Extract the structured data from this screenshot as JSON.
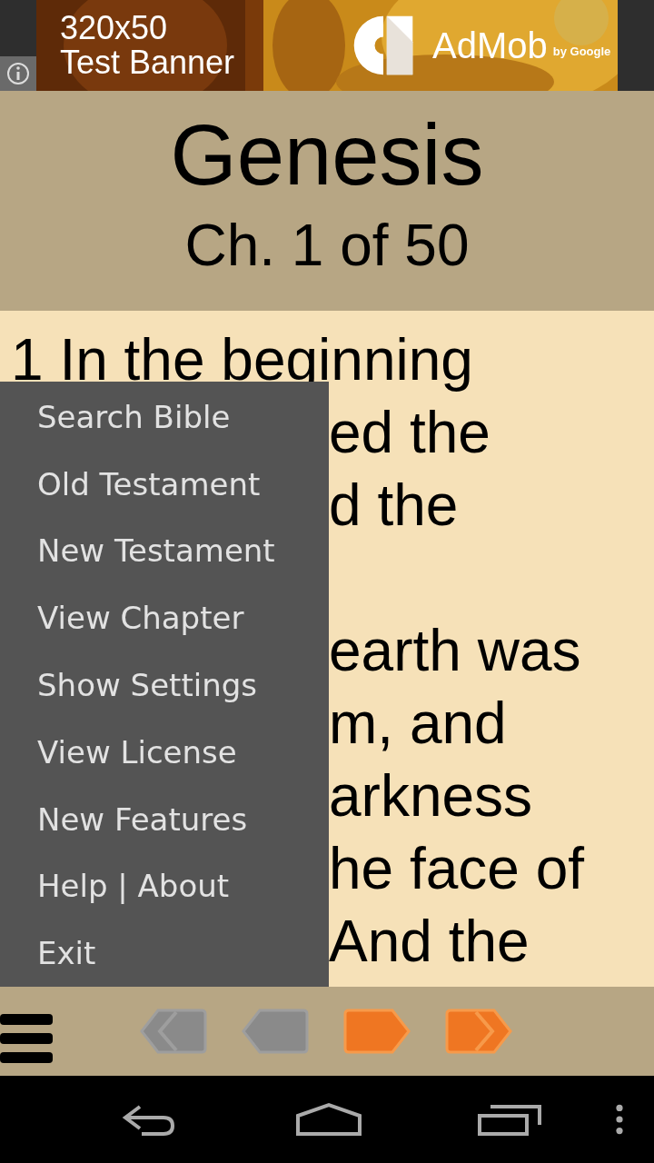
{
  "ad_banner": {
    "size_label": "320x50",
    "label": "Test Banner",
    "brand": "AdMob",
    "brand_suffix": "by Google"
  },
  "header": {
    "book": "Genesis",
    "chapter": "Ch. 1 of 50"
  },
  "verse_lines": [
    {
      "text": "1 In the beginning",
      "kind": "full"
    },
    {
      "text": "ed the",
      "kind": "partial"
    },
    {
      "text": "d the",
      "kind": "partial"
    },
    {
      "text": "earth was",
      "kind": "after-gap"
    },
    {
      "text": "m, and",
      "kind": "partial"
    },
    {
      "text": "arkness",
      "kind": "partial"
    },
    {
      "text": "he face of",
      "kind": "partial"
    },
    {
      "text": "And the",
      "kind": "partial"
    }
  ],
  "menu": {
    "items": [
      "Search Bible",
      "Old Testament",
      "New Testament",
      "View Chapter",
      "Show Settings",
      "View License",
      "New Features",
      "Help | About",
      "Exit"
    ]
  },
  "toolbar": {
    "buttons": [
      {
        "kind": "first",
        "disabled": true
      },
      {
        "kind": "prev",
        "disabled": true
      },
      {
        "kind": "next",
        "disabled": false
      },
      {
        "kind": "last",
        "disabled": false
      }
    ]
  }
}
